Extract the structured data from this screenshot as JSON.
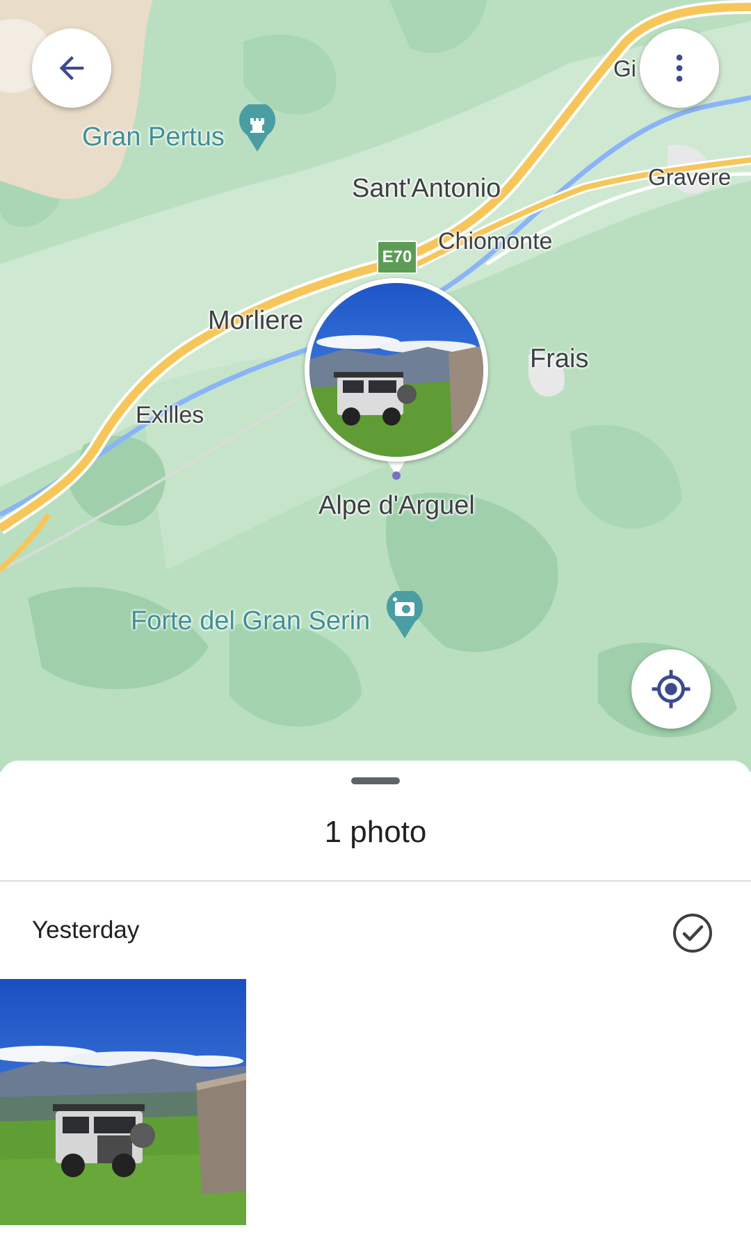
{
  "map": {
    "places": [
      {
        "id": "gran-pertus",
        "name": "Gran Pertus"
      },
      {
        "id": "sant-antonio",
        "name": "Sant'Antonio"
      },
      {
        "id": "chiomonte",
        "name": "Chiomonte"
      },
      {
        "id": "morliere",
        "name": "Morliere"
      },
      {
        "id": "frais",
        "name": "Frais"
      },
      {
        "id": "exilles",
        "name": "Exilles"
      },
      {
        "id": "alpe-darguel",
        "name": "Alpe d'Arguel"
      },
      {
        "id": "forte-gran-serin",
        "name": "Forte del Gran Serin"
      },
      {
        "id": "gravere",
        "name": "Gravere"
      },
      {
        "id": "gia",
        "name": "Gi"
      }
    ],
    "road_shield": "E70",
    "icons": {
      "back": "arrow-back-icon",
      "menu": "more-vert-icon",
      "locate": "my-location-icon",
      "castle_poi": "castle-icon",
      "photo_poi": "camera-plus-icon"
    },
    "colors": {
      "land": "#b9dfc0",
      "forest_dark": "#9fd0ab",
      "forest_light": "#cfe8d2",
      "highway": "#f6c65b",
      "water": "#8ab4f8",
      "poi": "#4a9ea3"
    }
  },
  "sheet": {
    "title": "1 photo",
    "section_date": "Yesterday",
    "photo_count": 1
  },
  "colors": {
    "accent": "#3c4b8f",
    "text": "#202124"
  }
}
